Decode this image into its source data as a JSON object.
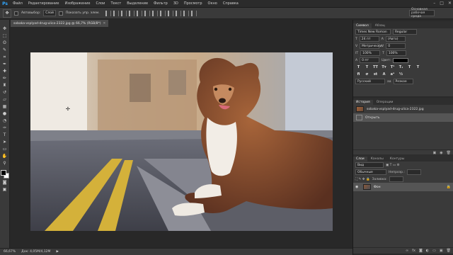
{
  "menubar": {
    "logo": "Ps",
    "items": [
      "Файл",
      "Редактирование",
      "Изображение",
      "Слои",
      "Текст",
      "Выделение",
      "Фильтр",
      "3D",
      "Просмотр",
      "Окно",
      "Справка"
    ]
  },
  "options": {
    "autoselect_label": "Автовыбор:",
    "autoselect_value": "Слой",
    "show_transform_label": "Показать упр. элем.",
    "workspace": "Основная рабочая среда"
  },
  "document": {
    "tab_title": "sobaka-vsplyad-drug-ulica-2322.jpg @ 66,7% (RGB/8*)",
    "zoom": "66,67%",
    "doc_size": "Док: 4,05M/4,12M"
  },
  "character_panel": {
    "tab_active": "Символ",
    "tab_other": "Абзац",
    "font_family": "Times New Roman",
    "font_style": "Regular",
    "font_size": "24 пт",
    "leading": "(Авто)",
    "kerning": "Метрически",
    "tracking": "0",
    "vscale": "100%",
    "hscale": "100%",
    "baseline": "0 пт",
    "color_label": "Цвет:",
    "language": "Русский",
    "antialias": "Резкое"
  },
  "history_panel": {
    "tab_active": "История",
    "tab_other": "Операции",
    "snapshot": "sobaka-vsplyad-drug-ulica-2322.jpg",
    "step": "Открыть"
  },
  "layers_panel": {
    "tabs": [
      "Слои",
      "Каналы",
      "Контуры"
    ],
    "kind": "Вид",
    "blend": "Обычные",
    "opacity_label": "Непрозр.:",
    "fill_label": "Заливка:",
    "layer_name": "Фон"
  }
}
